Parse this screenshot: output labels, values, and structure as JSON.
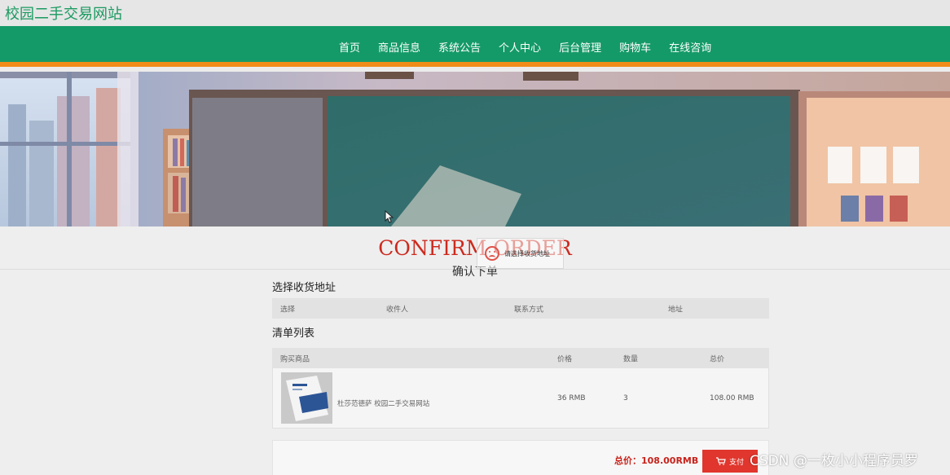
{
  "site": {
    "title": "校园二手交易网站"
  },
  "nav": {
    "items": [
      {
        "label": "首页"
      },
      {
        "label": "商品信息"
      },
      {
        "label": "系统公告"
      },
      {
        "label": "个人中心"
      },
      {
        "label": "后台管理"
      },
      {
        "label": "购物车"
      },
      {
        "label": "在线咨询"
      }
    ]
  },
  "colors": {
    "brand_green": "#149a68",
    "accent_orange": "#f08c1a",
    "alert_red": "#cc2a1e"
  },
  "page": {
    "heading_en": "CONFIRM ORDER",
    "heading_cn": "确认下单"
  },
  "toast": {
    "icon": "sad-face-icon",
    "message": "请选择收货地址"
  },
  "address": {
    "section_title": "选择收货地址",
    "columns": [
      "选择",
      "收件人",
      "联系方式",
      "地址"
    ]
  },
  "cart": {
    "section_title": "清单列表",
    "columns": [
      "购买商品",
      "价格",
      "数量",
      "总价"
    ],
    "rows": [
      {
        "name": "杜莎范德萨 校园二手交易网站",
        "price": "36 RMB",
        "qty": "3",
        "total": "108.00 RMB"
      }
    ]
  },
  "summary": {
    "total_label": "总价：108.00RMB",
    "pay_label": "支付",
    "pay_icon": "cart-icon"
  },
  "watermark": "CSDN @一枚小小程序员罗"
}
